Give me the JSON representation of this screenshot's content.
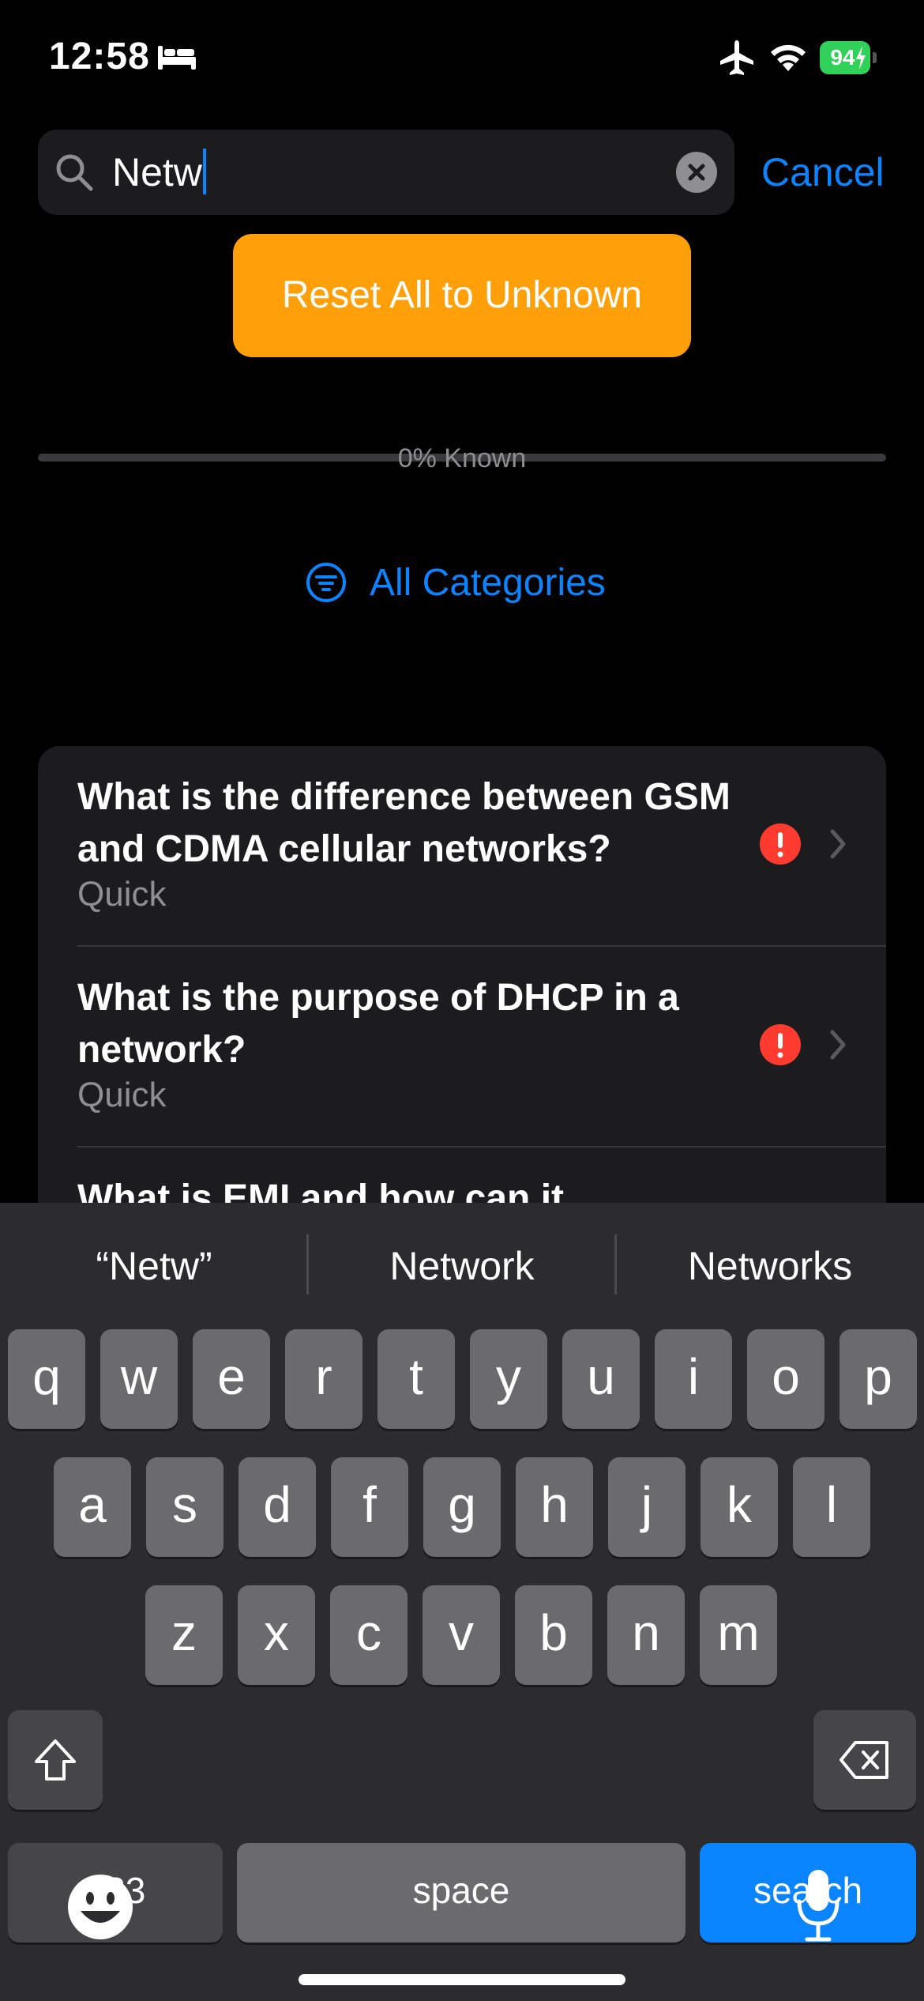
{
  "status_bar": {
    "time": "12:58",
    "battery": "94"
  },
  "search": {
    "value": "Netw",
    "cancel_label": "Cancel"
  },
  "reset_button_label": "Reset All to Unknown",
  "progress": {
    "fraction_known": 0,
    "label": "0% Known"
  },
  "categories_label": "All Categories",
  "list": {
    "items": [
      {
        "title": "What is the difference between GSM and CDMA cellular networks?",
        "subtitle": "Quick"
      },
      {
        "title": "What is the purpose of DHCP in a network?",
        "subtitle": "Quick"
      },
      {
        "title": "What is EMI and how can it",
        "subtitle": ""
      }
    ]
  },
  "keyboard": {
    "suggestions": [
      "“Netw”",
      "Network",
      "Networks"
    ],
    "row1": [
      "q",
      "w",
      "e",
      "r",
      "t",
      "y",
      "u",
      "i",
      "o",
      "p"
    ],
    "row2": [
      "a",
      "s",
      "d",
      "f",
      "g",
      "h",
      "j",
      "k",
      "l"
    ],
    "row3": [
      "z",
      "x",
      "c",
      "v",
      "b",
      "n",
      "m"
    ],
    "numbers_label": "123",
    "space_label": "space",
    "search_label": "search"
  },
  "colors": {
    "accent": "#0a84ff",
    "reset_button": "#ff9f0a",
    "alert": "#ff3b30",
    "battery": "#30d158"
  }
}
